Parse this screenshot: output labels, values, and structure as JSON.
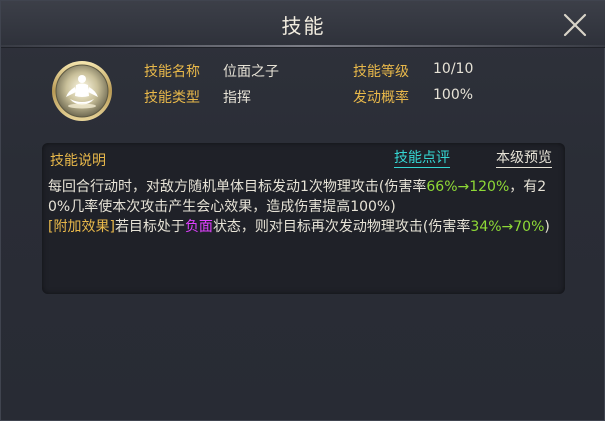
{
  "window": {
    "title": "技能",
    "close_icon": "close-icon"
  },
  "skill": {
    "icon": "meditating-figure-icon",
    "name_label": "技能名称",
    "name_value": "位面之子",
    "level_label": "技能等级",
    "level_value": "10/10",
    "type_label": "技能类型",
    "type_value": "指挥",
    "chance_label": "发动概率",
    "chance_value": "100%"
  },
  "description": {
    "header": "技能说明",
    "review_link": "技能点评",
    "preview_link": "本级预览",
    "line1_a": "每回合行动时，对敌方随机单体目标发动1次物理攻击(伤害率",
    "line1_rate": "66%→120%",
    "line1_b": "，有20%几率使本次攻击产生会心效果，造成伤害提高100%)",
    "extra_tag": "[附加效果]",
    "line2_a": "若目标处于",
    "line2_status": "负面",
    "line2_b": "状态，则对目标再次发动物理攻击(伤害率",
    "line2_rate": "34%→70%",
    "line2_c": ")"
  },
  "colors": {
    "label_gold": "#e8b84a",
    "value_green": "#8ed936",
    "debuff_magenta": "#e040ff",
    "link_cyan": "#35d6d2",
    "text": "#e6e2d6",
    "panel_bg": "#2a2d36",
    "box_bg": "#1f2128"
  }
}
